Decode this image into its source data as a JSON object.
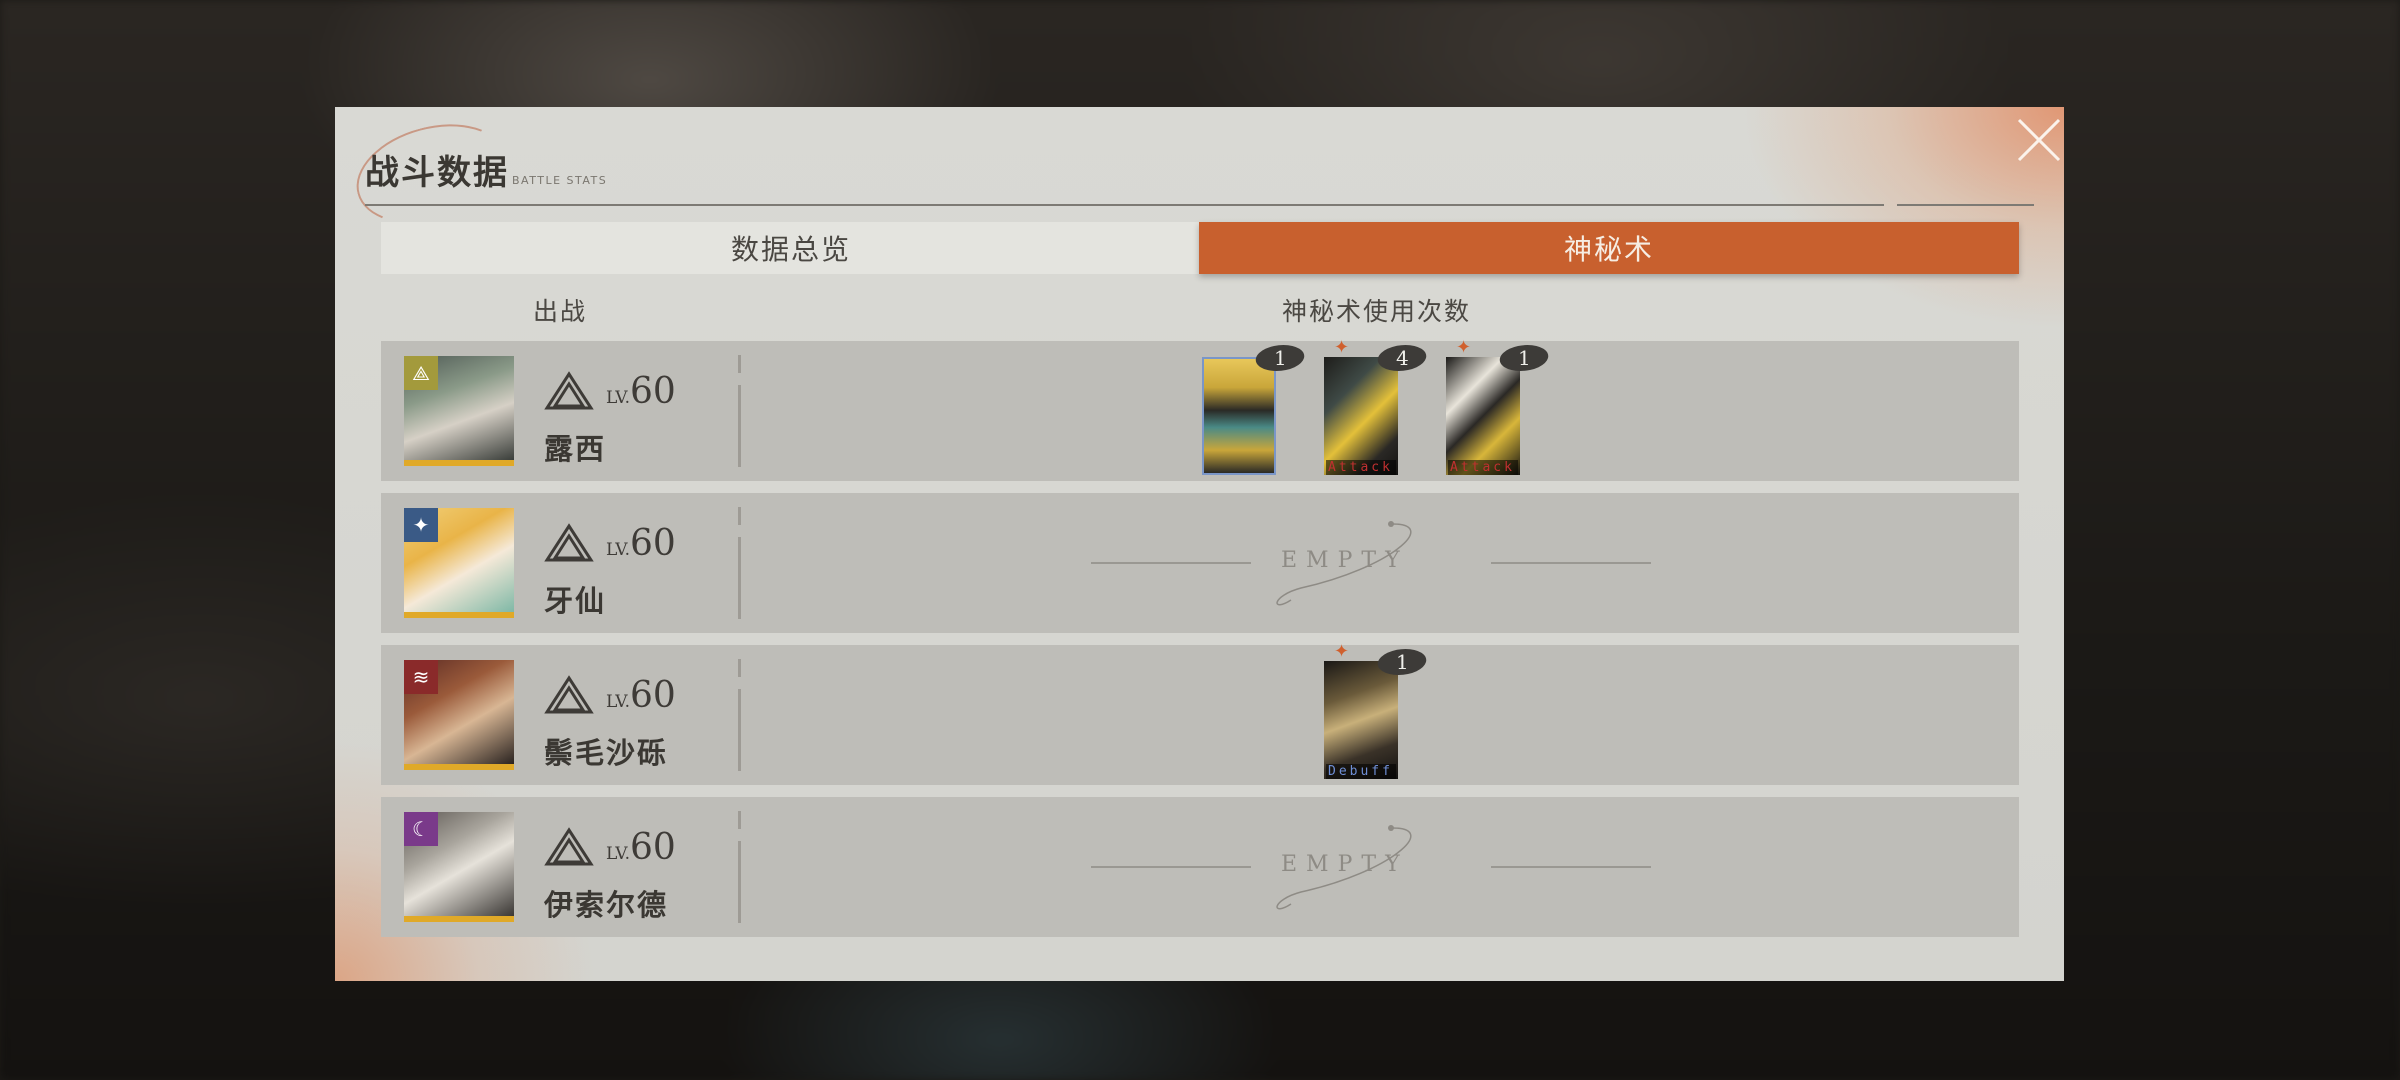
{
  "dialog": {
    "title": "战斗数据",
    "subtitle": "BATTLE STATS"
  },
  "tabs": [
    {
      "label": "数据总览",
      "active": false
    },
    {
      "label": "神秘术",
      "active": true
    }
  ],
  "columns": {
    "deployed": "出战",
    "arcanum_uses": "神秘术使用次数"
  },
  "colors": {
    "accent": "#c8602e",
    "panel": "#d6d6d1",
    "row": "#bebdb8",
    "portrait_rarity": "#e0a928"
  },
  "rows": [
    {
      "name": "露西",
      "level_label": "LV.",
      "level": "60",
      "afflatus_icon": "mineral-icon",
      "cards": [
        {
          "count": "1",
          "tag": "",
          "star": false
        },
        {
          "count": "4",
          "tag": "Attack",
          "star": true
        },
        {
          "count": "1",
          "tag": "Attack",
          "star": true
        }
      ],
      "empty": false
    },
    {
      "name": "牙仙",
      "level_label": "LV.",
      "level": "60",
      "afflatus_icon": "star-icon",
      "cards": [],
      "empty": true,
      "empty_text": "EMPTY"
    },
    {
      "name": "鬃毛沙砾",
      "level_label": "LV.",
      "level": "60",
      "afflatus_icon": "beast-icon",
      "cards": [
        {
          "count": "1",
          "tag": "Debuff",
          "star": true
        }
      ],
      "empty": false
    },
    {
      "name": "伊索尔德",
      "level_label": "LV.",
      "level": "60",
      "afflatus_icon": "spirit-icon",
      "cards": [],
      "empty": true,
      "empty_text": "EMPTY"
    }
  ]
}
